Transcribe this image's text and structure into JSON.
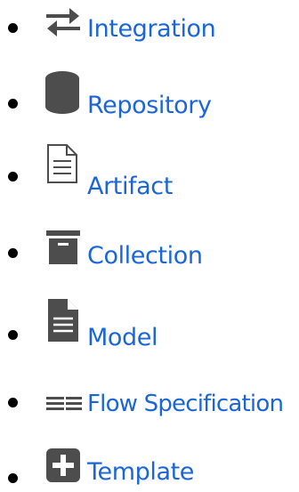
{
  "colors": {
    "link": "#1a66d9",
    "icon": "#4d4d4d",
    "bullet": "#000000"
  },
  "items": [
    {
      "label": "Integration",
      "icon": "swap-arrows-icon"
    },
    {
      "label": "Repository",
      "icon": "database-icon"
    },
    {
      "label": "Artifact",
      "icon": "file-text-outline-icon"
    },
    {
      "label": "Collection",
      "icon": "archive-box-icon"
    },
    {
      "label": "Model",
      "icon": "file-text-filled-icon"
    },
    {
      "label": "Flow Specification",
      "icon": "stream-lines-icon"
    },
    {
      "label": "Template",
      "icon": "plus-square-icon"
    }
  ]
}
